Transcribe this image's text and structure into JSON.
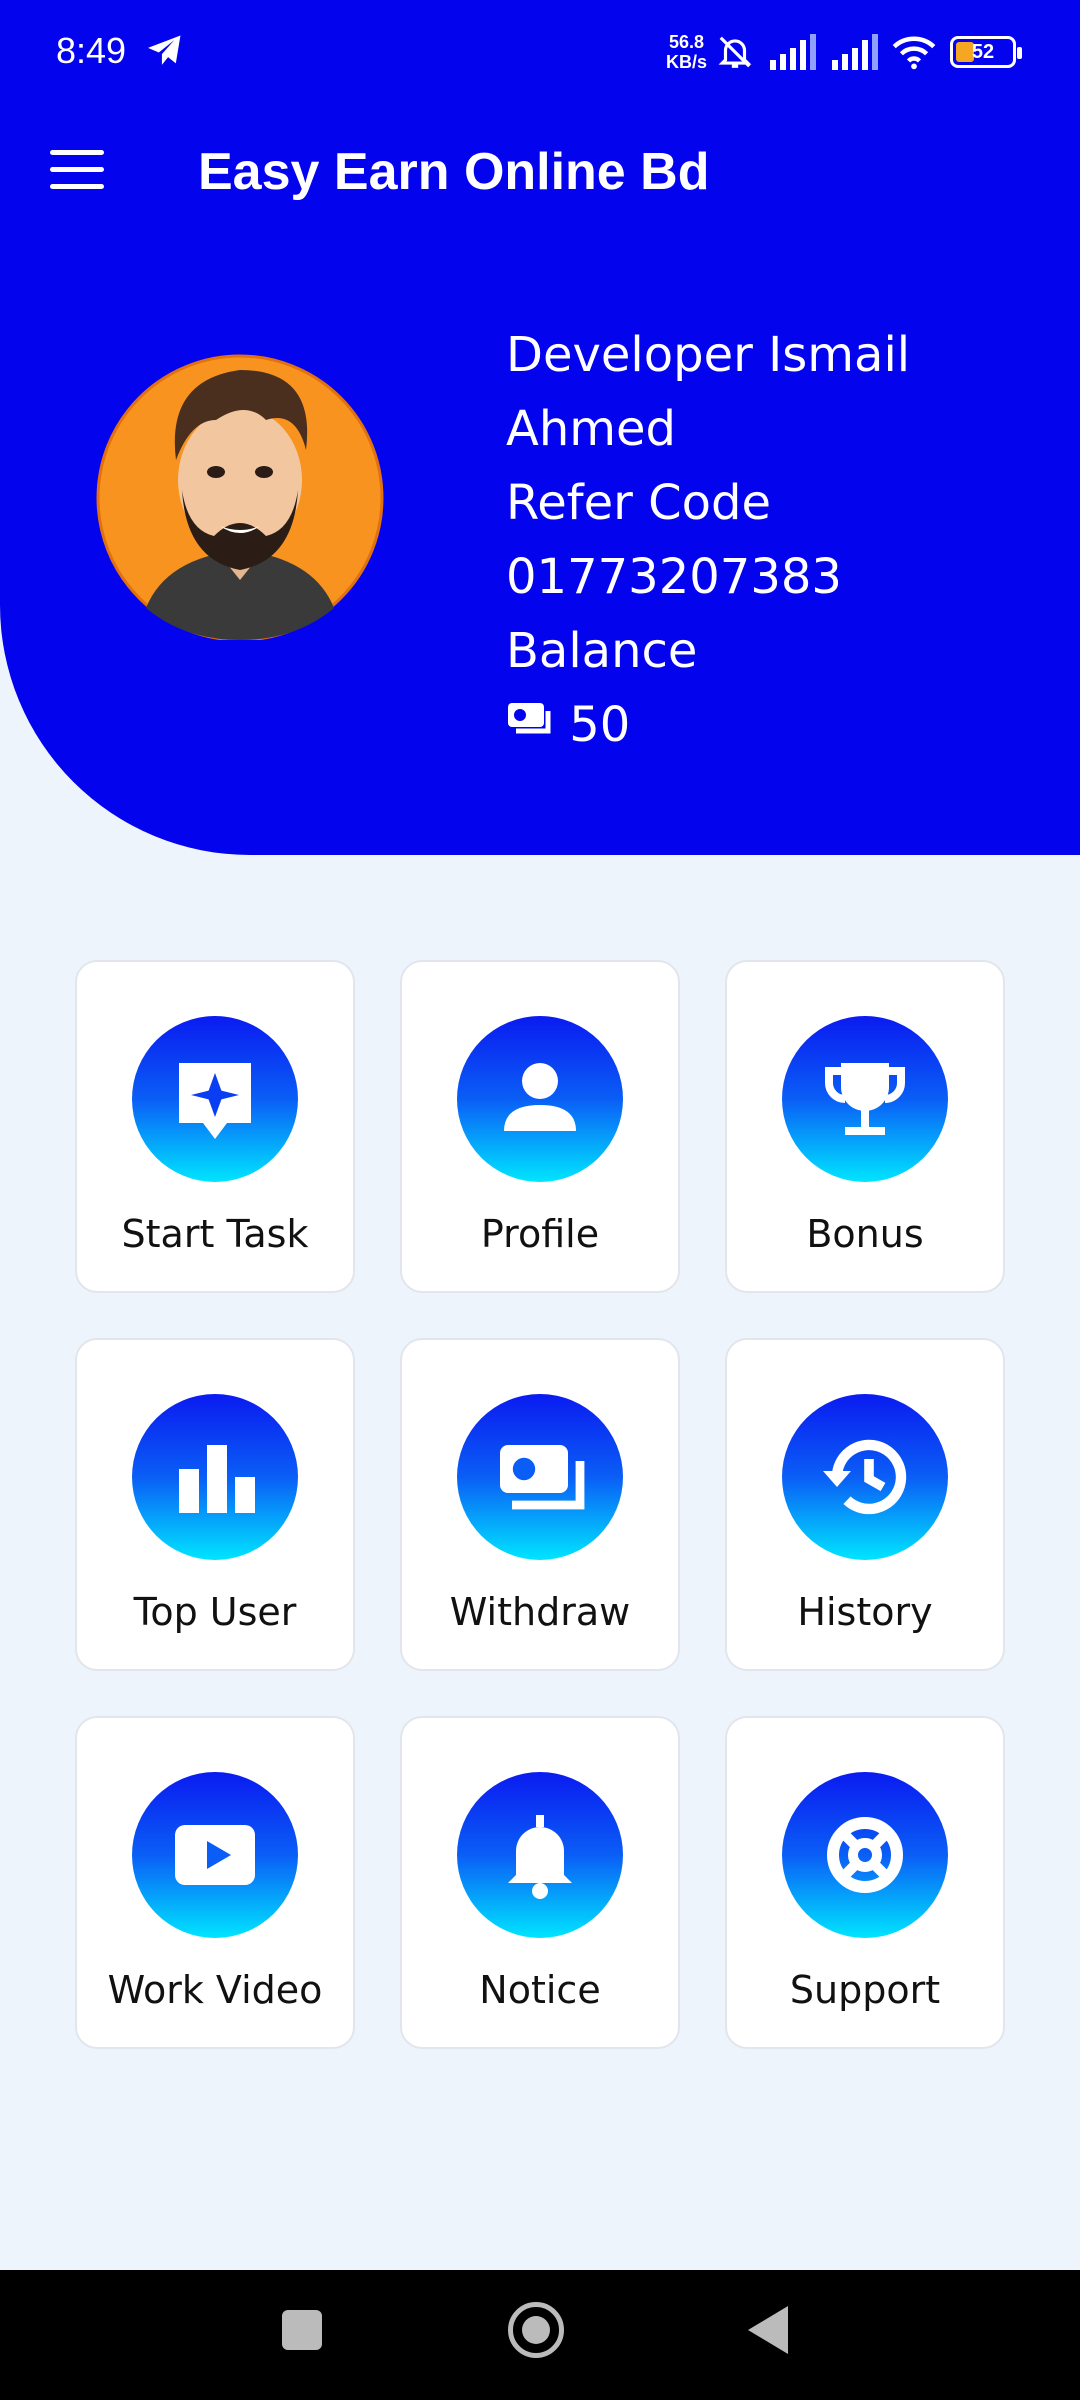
{
  "status_bar": {
    "time": "8:49",
    "net_speed_value": "56.8",
    "net_speed_unit": "KB/s",
    "battery": "52"
  },
  "app_bar": {
    "title": "Easy Earn Online Bd"
  },
  "profile": {
    "name_line1": "Developer Ismail",
    "name_line2": "Ahmed",
    "refer_label": "Refer Code",
    "refer_code": "01773207383",
    "balance_label": "Balance",
    "balance_value": "50"
  },
  "menu": [
    {
      "label": "Start Task",
      "icon": "sparkle-chat-icon"
    },
    {
      "label": "Profile",
      "icon": "person-icon"
    },
    {
      "label": "Bonus",
      "icon": "trophy-icon"
    },
    {
      "label": "Top User",
      "icon": "bar-chart-icon"
    },
    {
      "label": "Withdraw",
      "icon": "money-icon"
    },
    {
      "label": "History",
      "icon": "history-icon"
    },
    {
      "label": "Work Video",
      "icon": "play-icon"
    },
    {
      "label": "Notice",
      "icon": "bell-icon"
    },
    {
      "label": "Support",
      "icon": "support-icon"
    }
  ],
  "colors": {
    "header_blue": "#0303EE",
    "background": "#EEF4FC",
    "gradient_top": "#0A1BF0",
    "gradient_bottom": "#00E5FF"
  }
}
